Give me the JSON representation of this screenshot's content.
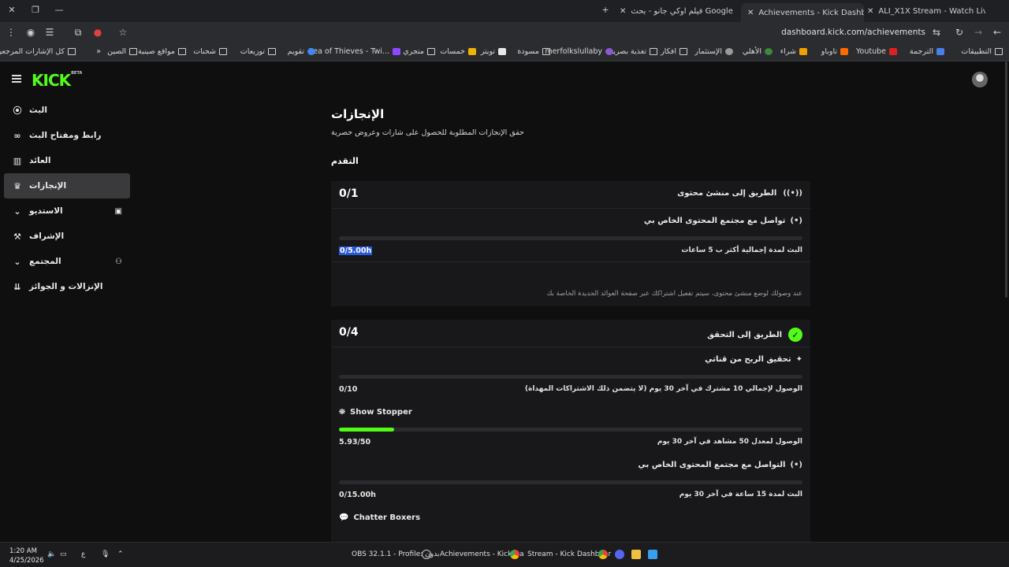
{
  "browser": {
    "tabs": [
      {
        "label": "ALI_X1X Stream - Watch Live on",
        "active": false
      },
      {
        "label": "Achievements - Kick Dashboard",
        "active": true
      },
      {
        "label": "فيلم اوكي جانو - بحث Google",
        "active": false
      }
    ],
    "url": "dashboard.kick.com/achievements",
    "bookmarks": [
      {
        "label": "التطبيقات"
      },
      {
        "label": "الترجمة"
      },
      {
        "label": "Youtube"
      },
      {
        "label": "تاوباو"
      },
      {
        "label": "شراء"
      },
      {
        "label": "الأهلي"
      },
      {
        "label": "الإستثمار"
      },
      {
        "label": "افكار"
      },
      {
        "label": "تغذية بصرية"
      },
      {
        "label": "merfolkslullaby"
      },
      {
        "label": "مسودة"
      },
      {
        "label": "تويتر"
      },
      {
        "label": "خمسات"
      },
      {
        "label": "متجري"
      },
      {
        "label": "Sea of Thieves - Twi..."
      },
      {
        "label": "تقويم"
      },
      {
        "label": "توزيعات"
      },
      {
        "label": "شحنات"
      },
      {
        "label": "مواقع صينية"
      },
      {
        "label": "الصين"
      },
      {
        "label": "كل الإشارات المرجعية"
      }
    ]
  },
  "app": {
    "logo": "KICK",
    "logo_tag": "BETA"
  },
  "sidebar": {
    "items": [
      {
        "label": "البث",
        "icon": "broadcast-icon"
      },
      {
        "label": "رابط ومفتاح البث",
        "icon": "link-icon"
      },
      {
        "label": "العائد",
        "icon": "chart-icon"
      },
      {
        "label": "الإنجازات",
        "icon": "trophy-icon",
        "active": true
      },
      {
        "label": "الاستديو",
        "icon": "studio-icon"
      },
      {
        "label": "الإشراف",
        "icon": "hammer-icon"
      },
      {
        "label": "المجتمع",
        "icon": "community-icon"
      },
      {
        "label": "الإنزالات و الجوائز",
        "icon": "drops-icon"
      }
    ]
  },
  "main": {
    "title": "الإنجازات",
    "subtitle": "حقق الإنجازات المطلوبة للحصول على شارات وعروض حصرية",
    "section": "التقدم",
    "cards": [
      {
        "count": "0/1",
        "title": "الطريق إلى منشئ محتوى",
        "achievements": [
          {
            "title": "تواصل مع مجتمع المحتوى الخاص بي",
            "requirement": "البث لمدة إجمالية أكثر ب 5 ساعات",
            "value": "0/5.00h",
            "progress": 0,
            "selected": true
          }
        ],
        "note": "عند وصولك لوضع منشئ محتوى، سيتم تفعيل اشتراكك عبر صفحة العوائد الجديدة الخاصة بك"
      },
      {
        "count": "0/4",
        "title": "الطريق إلى التحقق",
        "achievements": [
          {
            "title": "تحقيق الربح من قناتي",
            "requirement": "الوصول لإجمالي 10 مشترك في آخر 30 يوم (لا يتضمن ذلك الاشتراكات المهداة)",
            "value": "0/10",
            "progress": 0
          },
          {
            "title": "Show Stopper",
            "requirement": "الوصول لمعدل 50 مشاهد في آخر 30 يوم",
            "value": "5.93/50",
            "progress": 0.1186
          },
          {
            "title": "التواصل مع مجتمع المحتوى الخاص بي",
            "requirement": "البث لمدة 15 ساعة في آخر 30 يوم",
            "value": "0/15.00h",
            "progress": 0
          },
          {
            "title": "Chatter Boxers"
          }
        ]
      }
    ]
  },
  "taskbar": {
    "time": "1:20 AM",
    "date": "4/25/2026",
    "lang": "ع",
    "apps": [
      {
        "label": "OBS 32.1.1 - Profile: بدون"
      },
      {
        "label": "Achievements - Kick Da"
      },
      {
        "label": "Stream - Kick Dashboar"
      }
    ]
  },
  "colors": {
    "accent": "#53fc18",
    "background": "#0f0f10",
    "card": "#18181b"
  }
}
